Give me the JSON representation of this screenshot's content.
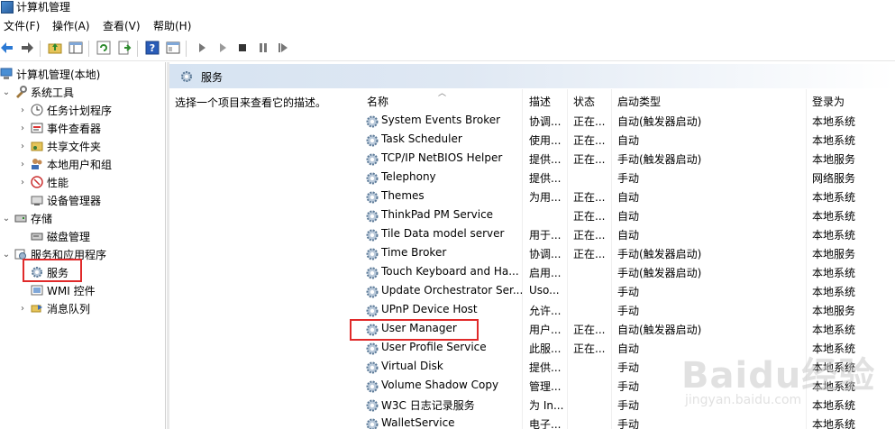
{
  "window": {
    "title": "计算机管理"
  },
  "menu": [
    {
      "label": "文件(F)"
    },
    {
      "label": "操作(A)"
    },
    {
      "label": "查看(V)"
    },
    {
      "label": "帮助(H)"
    }
  ],
  "toolbar": {
    "buttons": [
      "back-icon",
      "forward-icon",
      "up-folder-icon",
      "show-hide-tree-icon",
      "refresh-icon",
      "export-icon",
      "help-icon",
      "properties-icon",
      "play-icon",
      "play-outline-icon",
      "stop-icon",
      "pause-icon",
      "restart-icon"
    ]
  },
  "tree": {
    "root": "计算机管理(本地)",
    "items": [
      {
        "label": "系统工具"
      },
      {
        "label": "任务计划程序"
      },
      {
        "label": "事件查看器"
      },
      {
        "label": "共享文件夹"
      },
      {
        "label": "本地用户和组"
      },
      {
        "label": "性能"
      },
      {
        "label": "设备管理器"
      },
      {
        "label": "存储"
      },
      {
        "label": "磁盘管理"
      },
      {
        "label": "服务和应用程序"
      },
      {
        "label": "服务"
      },
      {
        "label": "WMI 控件"
      },
      {
        "label": "消息队列"
      }
    ]
  },
  "panel": {
    "title": "服务",
    "description": "选择一个项目来查看它的描述。"
  },
  "columns": {
    "name": "名称",
    "desc": "描述",
    "status": "状态",
    "start": "启动类型",
    "logon": "登录为"
  },
  "services": [
    {
      "name": "System Events Broker",
      "desc": "协调...",
      "status": "正在...",
      "start": "自动(触发器启动)",
      "logon": "本地系统"
    },
    {
      "name": "Task Scheduler",
      "desc": "使用...",
      "status": "正在...",
      "start": "自动",
      "logon": "本地系统"
    },
    {
      "name": "TCP/IP NetBIOS Helper",
      "desc": "提供...",
      "status": "正在...",
      "start": "手动(触发器启动)",
      "logon": "本地服务"
    },
    {
      "name": "Telephony",
      "desc": "提供...",
      "status": "",
      "start": "手动",
      "logon": "网络服务"
    },
    {
      "name": "Themes",
      "desc": "为用...",
      "status": "正在...",
      "start": "自动",
      "logon": "本地系统"
    },
    {
      "name": "ThinkPad PM Service",
      "desc": "",
      "status": "正在...",
      "start": "自动",
      "logon": "本地系统"
    },
    {
      "name": "Tile Data model server",
      "desc": "用于...",
      "status": "正在...",
      "start": "自动",
      "logon": "本地系统"
    },
    {
      "name": "Time Broker",
      "desc": "协调...",
      "status": "正在...",
      "start": "手动(触发器启动)",
      "logon": "本地服务"
    },
    {
      "name": "Touch Keyboard and Ha...",
      "desc": "启用...",
      "status": "",
      "start": "手动(触发器启动)",
      "logon": "本地系统"
    },
    {
      "name": "Update Orchestrator Ser...",
      "desc": "Uso...",
      "status": "",
      "start": "手动",
      "logon": "本地系统"
    },
    {
      "name": "UPnP Device Host",
      "desc": "允许...",
      "status": "",
      "start": "手动",
      "logon": "本地服务"
    },
    {
      "name": "User Manager",
      "desc": "用户...",
      "status": "正在...",
      "start": "自动(触发器启动)",
      "logon": "本地系统"
    },
    {
      "name": "User Profile Service",
      "desc": "此服...",
      "status": "正在...",
      "start": "自动",
      "logon": "本地系统"
    },
    {
      "name": "Virtual Disk",
      "desc": "提供...",
      "status": "",
      "start": "手动",
      "logon": "本地系统"
    },
    {
      "name": "Volume Shadow Copy",
      "desc": "管理...",
      "status": "",
      "start": "手动",
      "logon": "本地系统"
    },
    {
      "name": "W3C 日志记录服务",
      "desc": "为 In...",
      "status": "",
      "start": "手动",
      "logon": "本地系统"
    },
    {
      "name": "WalletService",
      "desc": "电子...",
      "status": "",
      "start": "手动",
      "logon": "本地系统"
    }
  ],
  "watermark": {
    "text": "Baidu经验",
    "sub": "jingyan.baidu.com"
  },
  "colors": {
    "highlight": "#e02a2a",
    "header_band": "#d6e3f2"
  }
}
